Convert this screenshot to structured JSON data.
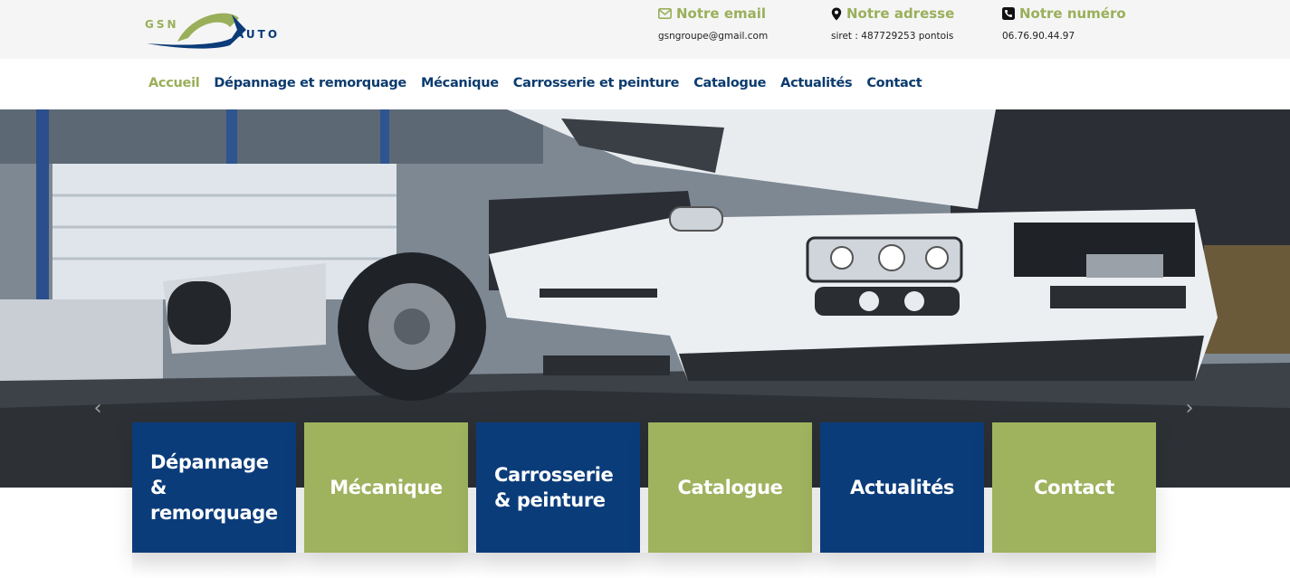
{
  "logo": {
    "part1": "GSN",
    "part2": "AUTO"
  },
  "contacts": {
    "email": {
      "icon": "envelope-icon",
      "label": "Notre email",
      "value": "gsngroupe@gmail.com"
    },
    "address": {
      "icon": "map-pin-icon",
      "label": "Notre adresse",
      "value": "siret : 487729253 pontois"
    },
    "phone": {
      "icon": "phone-icon",
      "label": "Notre numéro",
      "value": "06.76.90.44.97"
    }
  },
  "nav": {
    "items": [
      {
        "label": "Accueil",
        "active": true
      },
      {
        "label": "Dépannage et remorquage"
      },
      {
        "label": "Mécanique"
      },
      {
        "label": "Carrosserie et peinture"
      },
      {
        "label": "Catalogue"
      },
      {
        "label": "Actualités"
      },
      {
        "label": "Contact"
      }
    ]
  },
  "hero": {
    "prev_icon": "chevron-left-icon",
    "next_icon": "chevron-right-icon",
    "prev_glyph": "‹",
    "next_glyph": "›"
  },
  "tiles": [
    {
      "lines": [
        "Dépannage",
        "&",
        "remorquage"
      ],
      "color": "#0b3c7a"
    },
    {
      "lines": [
        "Mécanique"
      ],
      "color": "#9fb25e"
    },
    {
      "lines": [
        "Carrosserie",
        "& peinture"
      ],
      "color": "#0b3c7a"
    },
    {
      "lines": [
        "Catalogue"
      ],
      "color": "#9fb25e"
    },
    {
      "lines": [
        "Actualités"
      ],
      "color": "#0b3c7a"
    },
    {
      "lines": [
        "Contact"
      ],
      "color": "#9fb25e"
    }
  ],
  "colors": {
    "brand_green": "#9aaf5a",
    "brand_blue": "#0b3b78"
  }
}
